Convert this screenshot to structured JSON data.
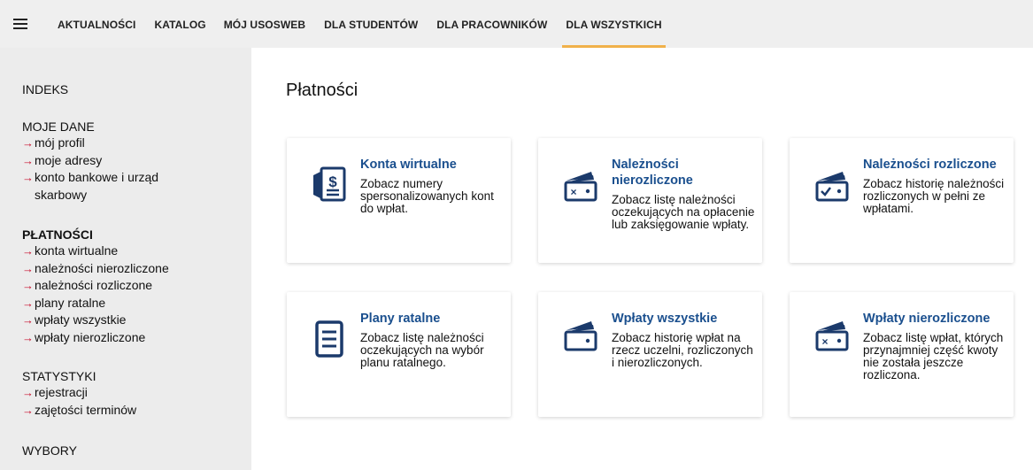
{
  "nav": {
    "tabs": [
      "AKTUALNOŚCI",
      "KATALOG",
      "MÓJ USOSWEB",
      "DLA STUDENTÓW",
      "DLA PRACOWNIKÓW",
      "DLA WSZYSTKICH"
    ],
    "active_index": 5
  },
  "sidebar": {
    "indeks": "INDEKS",
    "moje_dane": {
      "title": "MOJE DANE",
      "items": [
        "mój profil",
        "moje adresy",
        "konto bankowe i urząd",
        "skarbowy"
      ]
    },
    "platnosci": {
      "title": "PŁATNOŚCI",
      "items": [
        "konta wirtualne",
        "należności nierozliczone",
        "należności rozliczone",
        "plany ratalne",
        "wpłaty wszystkie",
        "wpłaty nierozliczone"
      ]
    },
    "statystyki": {
      "title": "STATYSTYKI",
      "items": [
        "rejestracji",
        "zajętości terminów"
      ]
    },
    "wybory": "WYBORY"
  },
  "main": {
    "title": "Płatności",
    "cards": [
      {
        "title": "Konta wirtualne",
        "desc": "Zobacz numery spersonalizowanych kont do wpłat.",
        "icon": "virtual-account-icon"
      },
      {
        "title": "Należności nierozliczone",
        "desc": "Zobacz listę należności oczekujących na opłacenie lub zaksięgowanie wpłaty.",
        "icon": "wallet-x-icon"
      },
      {
        "title": "Należności rozliczone",
        "desc": "Zobacz historię należności rozliczonych w pełni ze wpłatami.",
        "icon": "wallet-check-icon"
      },
      {
        "title": "Plany ratalne",
        "desc": "Zobacz listę należności oczekujących na wybór planu ratalnego.",
        "icon": "document-list-icon"
      },
      {
        "title": "Wpłaty wszystkie",
        "desc": "Zobacz historię wpłat na rzecz uczelni, rozliczonych i nierozliczonych.",
        "icon": "wallet-icon"
      },
      {
        "title": "Wpłaty nierozliczone",
        "desc": "Zobacz listę wpłat, których przynajmniej część kwoty nie została jeszcze rozliczona.",
        "icon": "wallet-x-icon"
      }
    ]
  },
  "colors": {
    "accent_underline": "#f0b14a",
    "link_blue": "#1a4f8e",
    "arrow_red": "#c8102e",
    "icon_navy": "#1b3a6b"
  }
}
